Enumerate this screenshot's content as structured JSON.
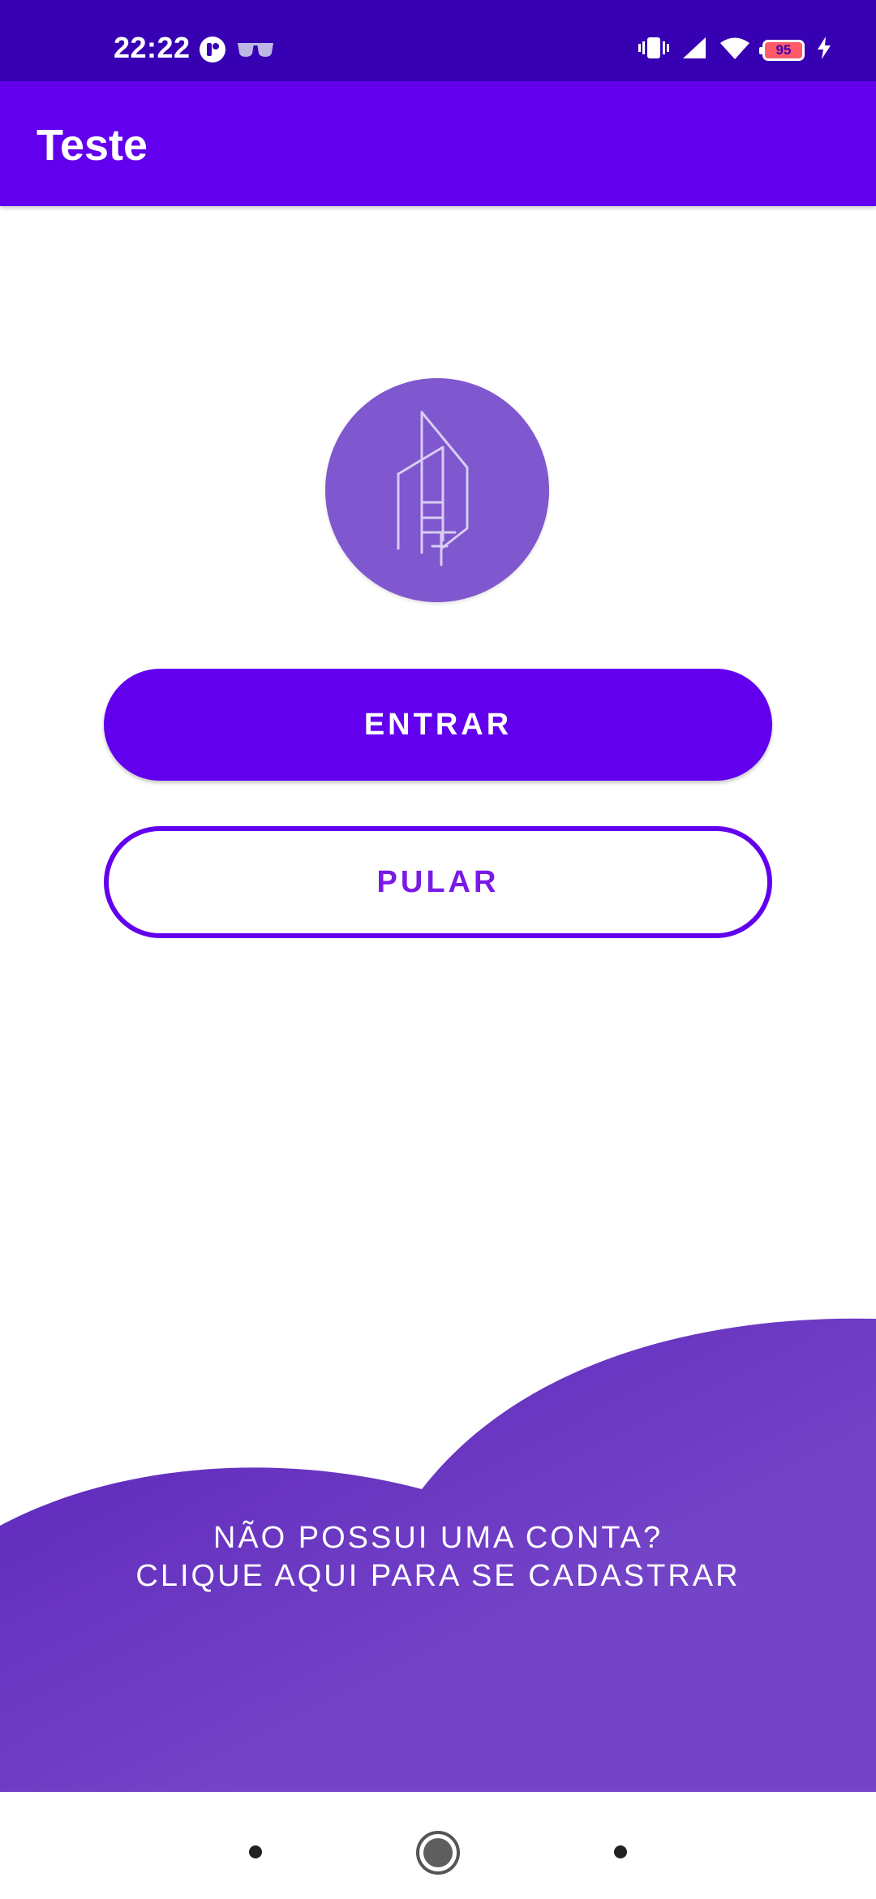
{
  "status_bar": {
    "time": "22:22",
    "battery_level": "95",
    "icons": [
      "app-notification-icon",
      "glasses-icon",
      "vibrate-icon",
      "signal-icon",
      "wifi-icon",
      "battery-icon",
      "charging-icon"
    ]
  },
  "app_bar": {
    "title": "Teste"
  },
  "logo": {
    "icon": "building-logo-icon"
  },
  "buttons": {
    "primary_label": "ENTRAR",
    "secondary_label": "PULAR"
  },
  "signup": {
    "line1": "NÃO POSSUI UMA CONTA?",
    "line2": "CLIQUE AQUI PARA SE CADASTRAR"
  },
  "nav_bar": {
    "icons": [
      "recents-dot-icon",
      "home-icon",
      "back-dot-icon"
    ]
  },
  "colors": {
    "status_bar": "#3700b3",
    "primary": "#6200ee",
    "logo_circle": "#7f57ce",
    "wave_top": "#5a22b8",
    "wave_bottom": "#7a46cc"
  }
}
